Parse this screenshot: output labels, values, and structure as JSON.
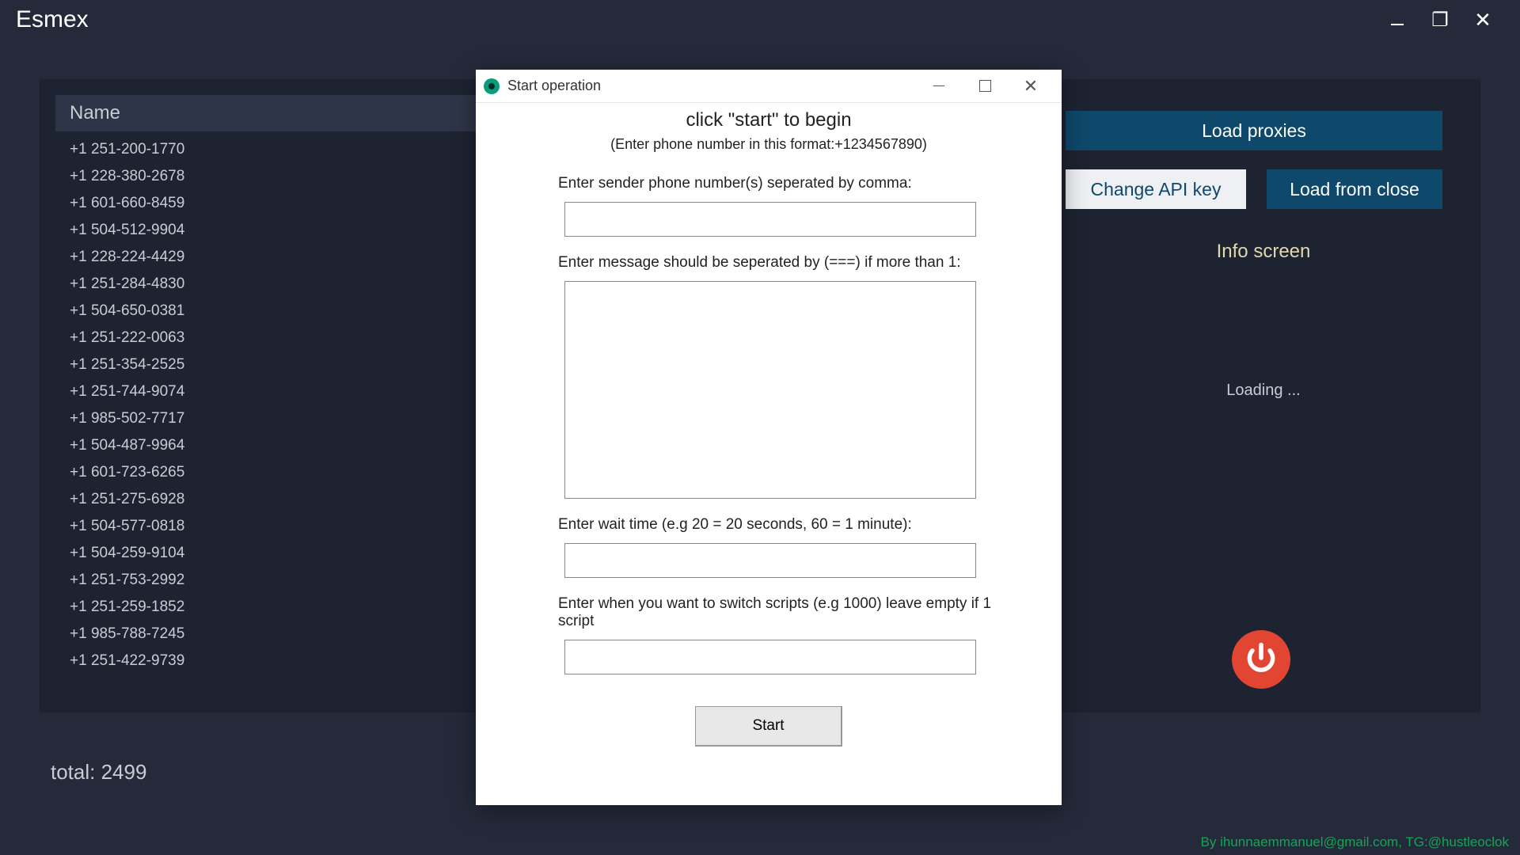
{
  "app": {
    "title": "Esmex"
  },
  "list": {
    "header": "Name",
    "rows": [
      "+1 251-200-1770",
      "+1 228-380-2678",
      "+1 601-660-8459",
      "+1 504-512-9904",
      "+1 228-224-4429",
      "+1 251-284-4830",
      "+1 504-650-0381",
      "+1 251-222-0063",
      "+1 251-354-2525",
      "+1 251-744-9074",
      "+1 985-502-7717",
      "+1 504-487-9964",
      "+1 601-723-6265",
      "+1 251-275-6928",
      "+1 504-577-0818",
      "+1 504-259-9104",
      "+1 251-753-2992",
      "+1 251-259-1852",
      "+1 985-788-7245",
      "+1 251-422-9739"
    ]
  },
  "right": {
    "load_proxies": "Load proxies",
    "change_api": "Change API key",
    "load_from_close": "Load from close",
    "info_title": "Info screen",
    "loading": "Loading ..."
  },
  "footer": {
    "total": "total: 2499",
    "credit": "By ihunnaemmanuel@gmail.com, TG:@hustleoclok"
  },
  "dialog": {
    "title": "Start operation",
    "heading": "click \"start\" to begin",
    "subheading": "(Enter phone number in this format:+1234567890)",
    "label_sender": "Enter sender phone number(s) seperated by comma:",
    "label_message": "Enter message should be seperated by (===) if more than 1:",
    "label_wait": "Enter wait time (e.g 20 = 20 seconds, 60 = 1 minute):",
    "label_switch": "Enter when you want to switch scripts (e.g 1000) leave empty if 1 script",
    "start": "Start",
    "sender_value": "",
    "message_value": "",
    "wait_value": "",
    "switch_value": ""
  }
}
